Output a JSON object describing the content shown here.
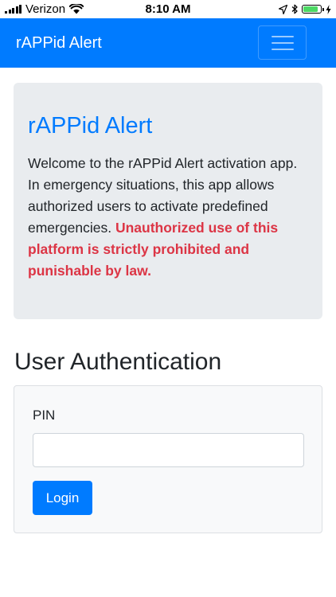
{
  "status_bar": {
    "carrier": "Verizon",
    "time": "8:10 AM",
    "icons": [
      "signal-icon",
      "wifi-icon",
      "location-icon",
      "bluetooth-icon",
      "battery-icon",
      "charging-icon"
    ],
    "battery_level": 0.85,
    "battery_color": "#4cd964"
  },
  "navbar": {
    "brand": "rAPPid Alert",
    "toggler_icon": "hamburger-menu-icon",
    "background": "#007bff"
  },
  "jumbotron": {
    "title": "rAPPid Alert",
    "text": "Welcome to the rAPPid Alert activation app. In emergency situations, this app allows authorized users to activate predefined emergencies.",
    "warning": "Unauthorized use of this platform is strictly prohibited and punishable by law.",
    "title_color": "#007bff",
    "warning_color": "#dc3545"
  },
  "auth": {
    "heading": "User Authentication",
    "pin_label": "PIN",
    "pin_value": "",
    "login_label": "Login"
  }
}
